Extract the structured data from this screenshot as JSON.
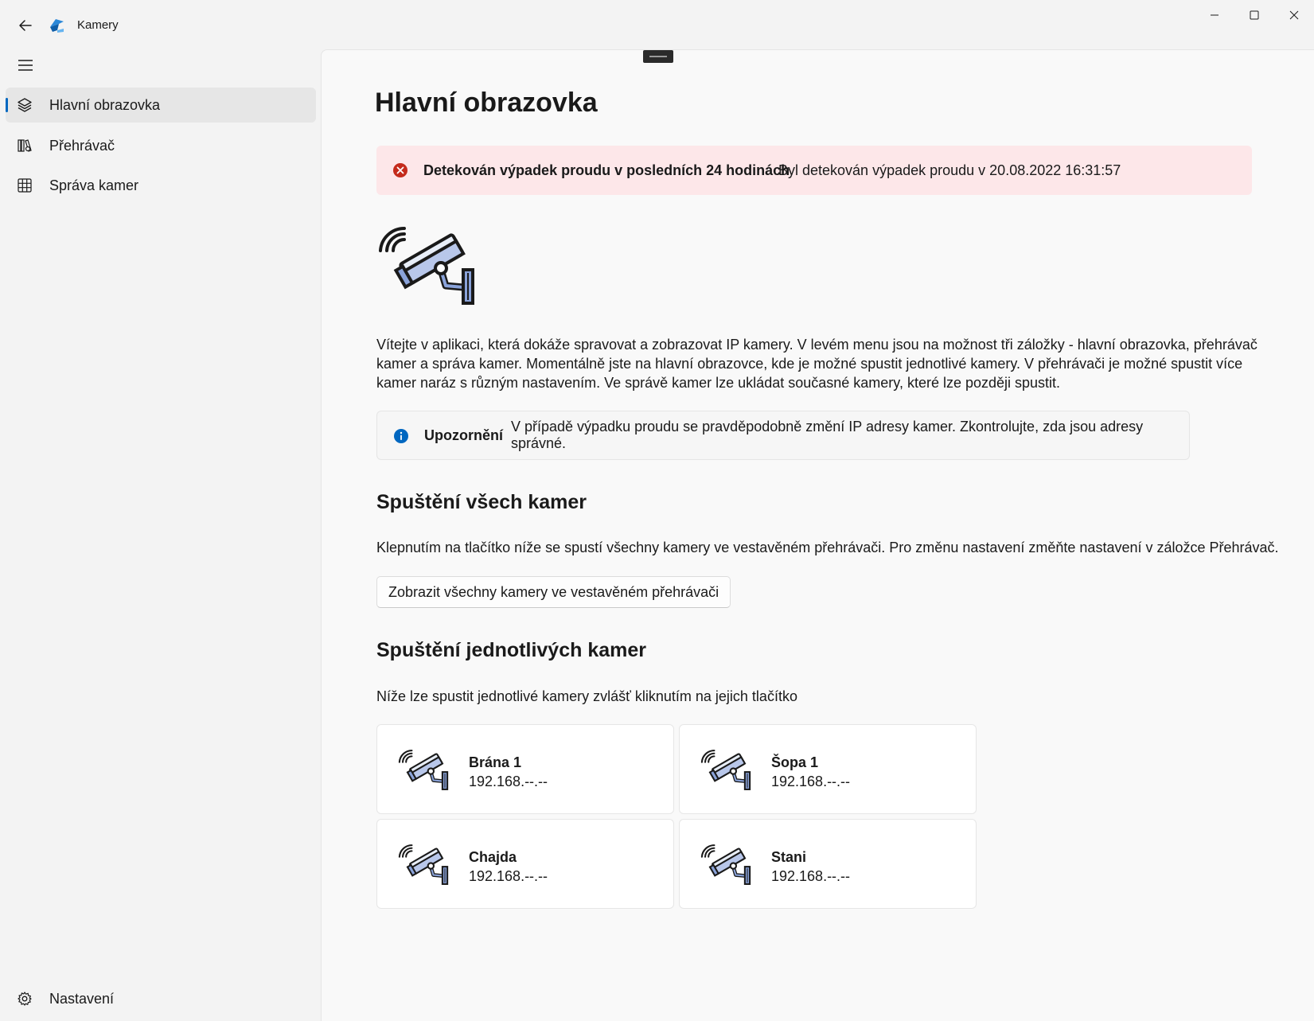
{
  "window": {
    "title": "Kamery",
    "accent": "#0067c0"
  },
  "sidebar": {
    "items": [
      {
        "label": "Hlavní obrazovka",
        "icon": "layers-icon",
        "active": true
      },
      {
        "label": "Přehrávač",
        "icon": "media-library-icon",
        "active": false
      },
      {
        "label": "Správa kamer",
        "icon": "grid-icon",
        "active": false
      }
    ],
    "settings_label": "Nastavení"
  },
  "main": {
    "title": "Hlavní obrazovka",
    "error_bar": {
      "title": "Detekován výpadek proudu v posledních 24 hodinách",
      "message": "Byl detekován výpadek proudu v 20.08.2022 16:31:57",
      "color": "#c42b1c"
    },
    "intro": "Vítejte v aplikaci, která dokáže spravovat a zobrazovat IP kamery. V levém menu jsou na možnost tři záložky - hlavní obrazovka, přehrávač kamer a správa kamer. Momentálně jste na hlavní obrazovce, kde je možné spustit jednotlivé kamery. V přehrávači je možné spustit více kamer naráz s různým nastavením. Ve správě kamer lze ukládat současné kamery, které lze později spustit.",
    "info_bar": {
      "title": "Upozornění",
      "message": "V případě výpadku proudu se pravděpodobně změní IP adresy kamer. Zkontrolujte, zda jsou adresy správné.",
      "color": "#0067c0"
    },
    "all_cameras": {
      "title": "Spuštění všech kamer",
      "description": "Klepnutím na tlačítko níže se spustí všechny kamery ve vestavěném přehrávači. Pro změnu nastavení změňte nastavení v záložce Přehrávač.",
      "button_label": "Zobrazit všechny kamery ve vestavěném přehrávači"
    },
    "single_cameras": {
      "title": "Spuštění jednotlivých kamer",
      "description": "Níže lze spustit jednotlivé kamery zvlášť kliknutím na jejich tlačítko",
      "cameras": [
        {
          "name": "Brána 1",
          "ip": "192.168.--.--"
        },
        {
          "name": "Šopa 1",
          "ip": "192.168.--.--"
        },
        {
          "name": "Chajda",
          "ip": "192.168.--.--"
        },
        {
          "name": "Stani",
          "ip": "192.168.--.--"
        }
      ]
    }
  }
}
